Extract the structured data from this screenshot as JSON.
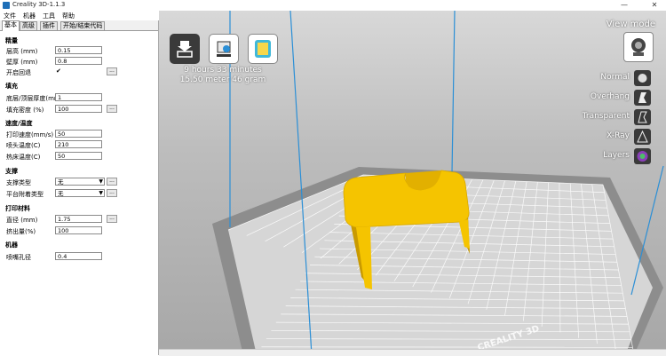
{
  "window": {
    "title": "Creality 3D-1.1.3",
    "minimize": "—",
    "close": "✕"
  },
  "menu": [
    "文件",
    "机器",
    "工具",
    "帮助"
  ],
  "tabs": [
    "基本",
    "高级",
    "插件",
    "开始/结束代码"
  ],
  "sections": {
    "quality": "精量",
    "fill": "填充",
    "speed": "速度/温度",
    "support": "支撑",
    "material": "打印材料",
    "machine": "机器"
  },
  "fields": {
    "layer_height": {
      "label": "层高 (mm)",
      "value": "0.15"
    },
    "wall_thickness": {
      "label": "壁厚 (mm)",
      "value": "0.8"
    },
    "retraction": {
      "label": "开启回退",
      "checked": "✔"
    },
    "bottom_top": {
      "label": "底层/顶层厚度(mm)",
      "value": "1"
    },
    "fill_density": {
      "label": "填充密度 (%)",
      "value": "100"
    },
    "print_speed": {
      "label": "打印速度(mm/s)",
      "value": "50"
    },
    "nozzle_temp": {
      "label": "喷头温度(C)",
      "value": "210"
    },
    "bed_temp": {
      "label": "热床温度(C)",
      "value": "50"
    },
    "support_type": {
      "label": "支撑类型",
      "value": "无"
    },
    "platform_adhesion": {
      "label": "平台附着类型",
      "value": "无"
    },
    "diameter": {
      "label": "直径 (mm)",
      "value": "1.75"
    },
    "flow": {
      "label": "挤出量(%)",
      "value": "100"
    },
    "nozzle_size": {
      "label": "喷嘴孔径",
      "value": "0.4"
    }
  },
  "dots": "...",
  "print_info": {
    "time": "9 hours 33 minutes",
    "material": "15.50 meter 46 gram"
  },
  "view_mode": {
    "title": "View mode",
    "options": [
      "Normal",
      "Overhang",
      "Transparent",
      "X-Ray",
      "Layers"
    ]
  },
  "bed_brand": "CREALITY 3D",
  "colors": {
    "model": "#f5c400",
    "model_dark": "#c99a00",
    "bed": "#d6d6d6",
    "grid": "#ffffff",
    "frame": "#2b8fd6"
  }
}
